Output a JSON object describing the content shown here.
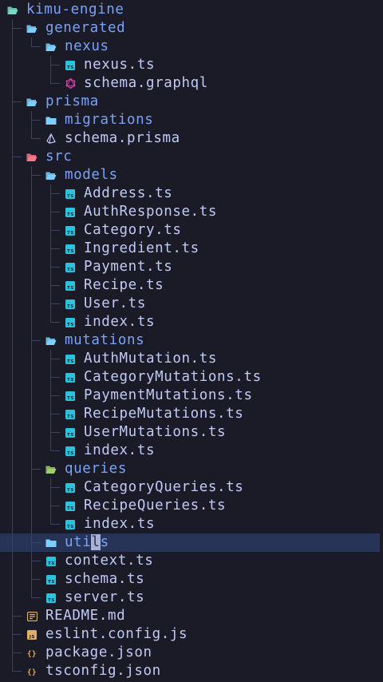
{
  "theme": {
    "background": "#1a1b26",
    "directory_text": "#7aa2f7",
    "file_text": "#c0caf5",
    "guide_line": "#3b4261",
    "selection": "#283457",
    "folder_icon": "#7dcfff",
    "folder_icon_root": "#73daca",
    "folder_icon_src": "#f7768e",
    "folder_icon_queries": "#9ece6a",
    "ts_icon": "#2ac3de",
    "graphql_icon": "#e535ab",
    "prisma_icon": "#c0caf5",
    "readme_icon": "#e0af68",
    "js_icon": "#e0af68",
    "json_icon": "#e0af68"
  },
  "tree": [
    {
      "label": "kimu-engine",
      "type": "dir",
      "open": true,
      "icon": "folder-open-icon",
      "depth": 0,
      "last": false
    },
    {
      "label": "generated",
      "type": "dir",
      "open": true,
      "icon": "folder-open-icon",
      "depth": 1,
      "last": false
    },
    {
      "label": "nexus",
      "type": "dir",
      "open": true,
      "icon": "folder-open-icon",
      "depth": 2,
      "last": true
    },
    {
      "label": "nexus.ts",
      "type": "file",
      "icon": "typescript-icon",
      "depth": 3,
      "last": false
    },
    {
      "label": "schema.graphql",
      "type": "file",
      "icon": "graphql-icon",
      "depth": 3,
      "last": true
    },
    {
      "label": "prisma",
      "type": "dir",
      "open": true,
      "icon": "folder-open-icon",
      "depth": 1,
      "last": false
    },
    {
      "label": "migrations",
      "type": "dir",
      "open": false,
      "icon": "folder-closed-icon",
      "depth": 2,
      "last": false
    },
    {
      "label": "schema.prisma",
      "type": "file",
      "icon": "prisma-icon",
      "depth": 2,
      "last": true
    },
    {
      "label": "src",
      "type": "dir",
      "open": true,
      "icon": "folder-open-icon",
      "depth": 1,
      "last": false
    },
    {
      "label": "models",
      "type": "dir",
      "open": true,
      "icon": "folder-open-icon",
      "depth": 2,
      "last": false
    },
    {
      "label": "Address.ts",
      "type": "file",
      "icon": "typescript-icon",
      "depth": 3,
      "last": false
    },
    {
      "label": "AuthResponse.ts",
      "type": "file",
      "icon": "typescript-icon",
      "depth": 3,
      "last": false
    },
    {
      "label": "Category.ts",
      "type": "file",
      "icon": "typescript-icon",
      "depth": 3,
      "last": false
    },
    {
      "label": "Ingredient.ts",
      "type": "file",
      "icon": "typescript-icon",
      "depth": 3,
      "last": false
    },
    {
      "label": "Payment.ts",
      "type": "file",
      "icon": "typescript-icon",
      "depth": 3,
      "last": false
    },
    {
      "label": "Recipe.ts",
      "type": "file",
      "icon": "typescript-icon",
      "depth": 3,
      "last": false
    },
    {
      "label": "User.ts",
      "type": "file",
      "icon": "typescript-icon",
      "depth": 3,
      "last": false
    },
    {
      "label": "index.ts",
      "type": "file",
      "icon": "typescript-icon",
      "depth": 3,
      "last": true
    },
    {
      "label": "mutations",
      "type": "dir",
      "open": true,
      "icon": "folder-open-icon",
      "depth": 2,
      "last": false
    },
    {
      "label": "AuthMutation.ts",
      "type": "file",
      "icon": "typescript-icon",
      "depth": 3,
      "last": false
    },
    {
      "label": "CategoryMutations.ts",
      "type": "file",
      "icon": "typescript-icon",
      "depth": 3,
      "last": false
    },
    {
      "label": "PaymentMutations.ts",
      "type": "file",
      "icon": "typescript-icon",
      "depth": 3,
      "last": false
    },
    {
      "label": "RecipeMutations.ts",
      "type": "file",
      "icon": "typescript-icon",
      "depth": 3,
      "last": false
    },
    {
      "label": "UserMutations.ts",
      "type": "file",
      "icon": "typescript-icon",
      "depth": 3,
      "last": false
    },
    {
      "label": "index.ts",
      "type": "file",
      "icon": "typescript-icon",
      "depth": 3,
      "last": true
    },
    {
      "label": "queries",
      "type": "dir",
      "open": true,
      "icon": "folder-open-icon",
      "depth": 2,
      "last": false
    },
    {
      "label": "CategoryQueries.ts",
      "type": "file",
      "icon": "typescript-icon",
      "depth": 3,
      "last": false
    },
    {
      "label": "RecipeQueries.ts",
      "type": "file",
      "icon": "typescript-icon",
      "depth": 3,
      "last": false
    },
    {
      "label": "index.ts",
      "type": "file",
      "icon": "typescript-icon",
      "depth": 3,
      "last": true
    },
    {
      "label": "utils",
      "type": "dir",
      "open": false,
      "icon": "folder-closed-icon",
      "depth": 2,
      "last": false,
      "selected": true,
      "cursor_char_index": 3
    },
    {
      "label": "context.ts",
      "type": "file",
      "icon": "typescript-icon",
      "depth": 2,
      "last": false
    },
    {
      "label": "schema.ts",
      "type": "file",
      "icon": "typescript-icon",
      "depth": 2,
      "last": false
    },
    {
      "label": "server.ts",
      "type": "file",
      "icon": "typescript-icon",
      "depth": 2,
      "last": true
    },
    {
      "label": "README.md",
      "type": "file",
      "icon": "readme-icon",
      "depth": 1,
      "last": false
    },
    {
      "label": "eslint.config.js",
      "type": "file",
      "icon": "javascript-icon",
      "depth": 1,
      "last": false
    },
    {
      "label": "package.json",
      "type": "file",
      "icon": "json-icon",
      "depth": 1,
      "last": false
    },
    {
      "label": "tsconfig.json",
      "type": "file",
      "icon": "json-icon",
      "depth": 1,
      "last": true
    }
  ]
}
